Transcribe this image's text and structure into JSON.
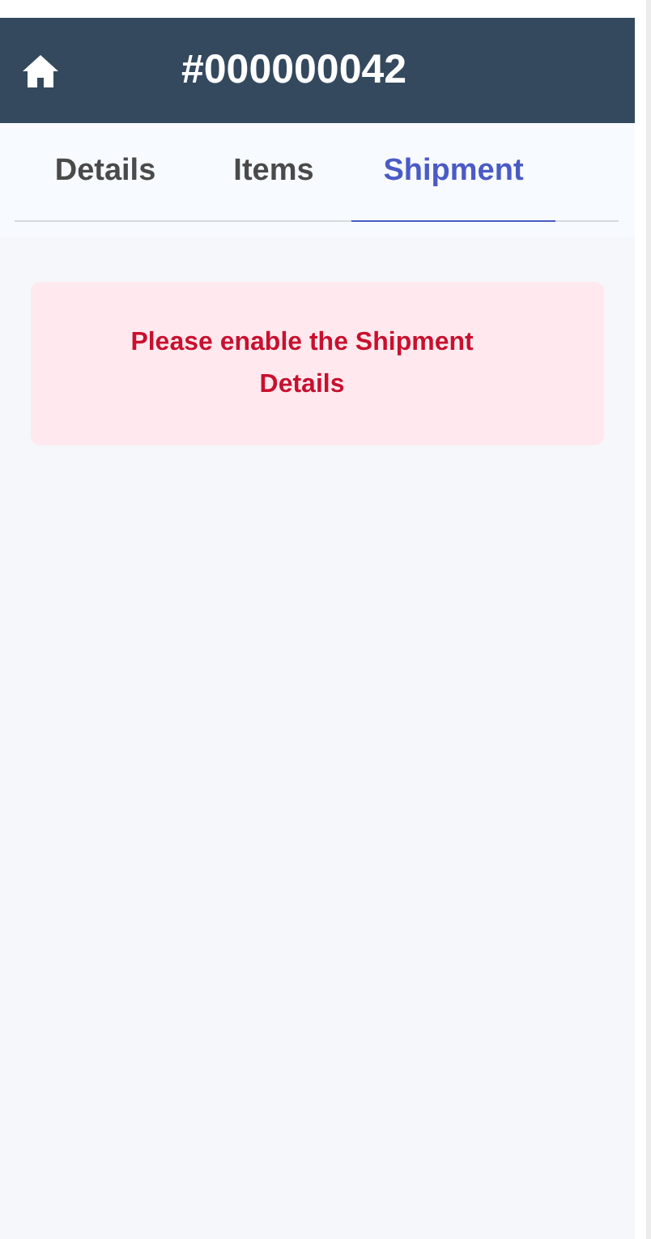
{
  "header": {
    "title": "#000000042"
  },
  "tabs": [
    {
      "label": "Details",
      "selected": false
    },
    {
      "label": "Items",
      "selected": false
    },
    {
      "label": "Shipment",
      "selected": true
    }
  ],
  "alert": {
    "message": "Please enable the Shipment Details"
  }
}
